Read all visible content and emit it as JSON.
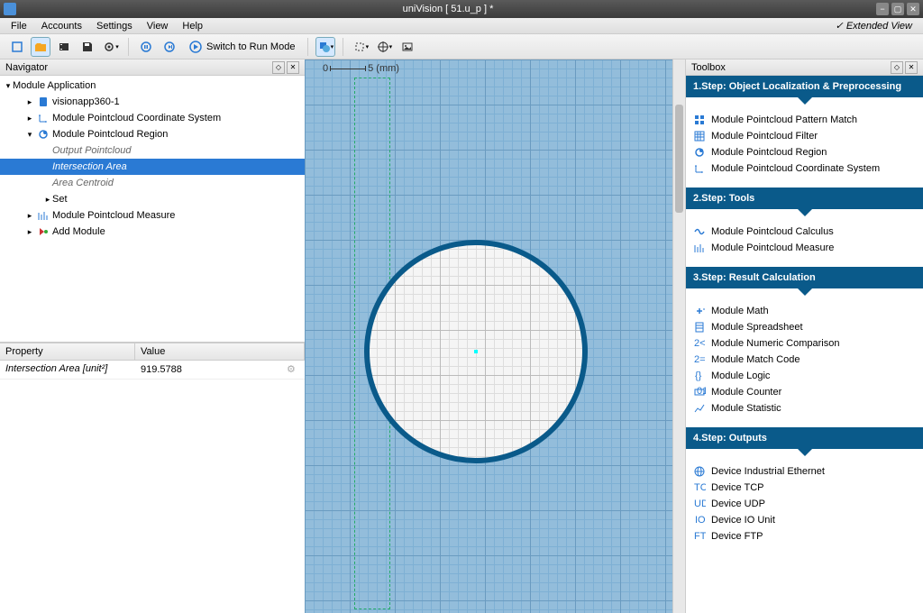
{
  "window": {
    "title": "uniVision [ 51.u_p ] *"
  },
  "menubar": {
    "items": [
      "File",
      "Accounts",
      "Settings",
      "View",
      "Help"
    ],
    "extendedView": "Extended View"
  },
  "toolbar": {
    "runMode": "Switch to Run Mode"
  },
  "navigator": {
    "title": "Navigator",
    "root": "Module Application",
    "items": [
      {
        "label": "visionapp360-1",
        "indent": 1,
        "icon": "device"
      },
      {
        "label": "Module Pointcloud Coordinate System",
        "indent": 1,
        "icon": "coord"
      },
      {
        "label": "Module Pointcloud Region",
        "indent": 1,
        "icon": "region",
        "expanded": true
      },
      {
        "label": "Output Pointcloud",
        "indent": 2,
        "italic": true
      },
      {
        "label": "Intersection Area",
        "indent": 2,
        "italic": true,
        "selected": true
      },
      {
        "label": "Area Centroid",
        "indent": 2,
        "italic": true
      },
      {
        "label": "Set",
        "indent": 2
      },
      {
        "label": "Module Pointcloud Measure",
        "indent": 1,
        "icon": "measure"
      },
      {
        "label": "Add Module",
        "indent": 1,
        "icon": "add"
      }
    ]
  },
  "properties": {
    "headers": {
      "property": "Property",
      "value": "Value"
    },
    "rows": [
      {
        "name": "Intersection Area [unit²]",
        "value": "919.5788"
      }
    ]
  },
  "canvas": {
    "rulerStart": "0",
    "rulerEnd": "5 (mm)"
  },
  "toolbox": {
    "title": "Toolbox",
    "steps": [
      {
        "title": "1.Step: Object Localization & Preprocessing",
        "items": [
          {
            "label": "Module Pointcloud Pattern Match",
            "icon": "pattern"
          },
          {
            "label": "Module Pointcloud Filter",
            "icon": "filter"
          },
          {
            "label": "Module Pointcloud Region",
            "icon": "region"
          },
          {
            "label": "Module Pointcloud Coordinate System",
            "icon": "coord"
          }
        ]
      },
      {
        "title": "2.Step: Tools",
        "items": [
          {
            "label": "Module Pointcloud Calculus",
            "icon": "calc"
          },
          {
            "label": "Module Pointcloud Measure",
            "icon": "measure"
          }
        ]
      },
      {
        "title": "3.Step: Result Calculation",
        "items": [
          {
            "label": "Module Math",
            "icon": "math"
          },
          {
            "label": "Module Spreadsheet",
            "icon": "sheet"
          },
          {
            "label": "Module Numeric Comparison",
            "icon": "numcomp"
          },
          {
            "label": "Module Match Code",
            "icon": "matchcode"
          },
          {
            "label": "Module Logic",
            "icon": "logic"
          },
          {
            "label": "Module Counter",
            "icon": "counter"
          },
          {
            "label": "Module Statistic",
            "icon": "stat"
          }
        ]
      },
      {
        "title": "4.Step: Outputs",
        "items": [
          {
            "label": "Device Industrial Ethernet",
            "icon": "eth"
          },
          {
            "label": "Device TCP",
            "icon": "tcp"
          },
          {
            "label": "Device UDP",
            "icon": "udp"
          },
          {
            "label": "Device IO Unit",
            "icon": "io"
          },
          {
            "label": "Device FTP",
            "icon": "ftp"
          }
        ]
      }
    ]
  }
}
